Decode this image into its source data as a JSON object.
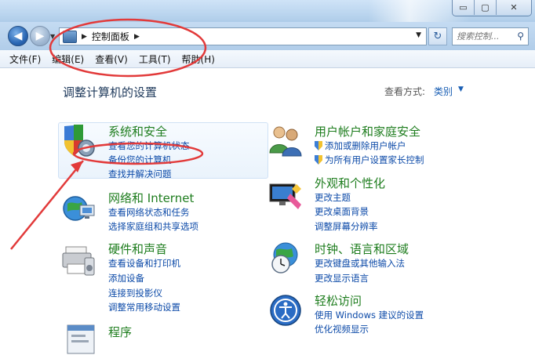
{
  "window": {
    "minimize": "▭",
    "maximize": "▢",
    "close": "✕"
  },
  "nav": {
    "back": "◀",
    "forward": "▶",
    "dropdown": "▼"
  },
  "address": {
    "separator": "▶",
    "location": "控制面板",
    "trail_arrow": "▶",
    "dropdown": "▼",
    "refresh": "↻"
  },
  "search": {
    "placeholder": "搜索控制...",
    "icon": "⚲"
  },
  "menu": [
    "文件(F)",
    "编辑(E)",
    "查看(V)",
    "工具(T)",
    "帮助(H)"
  ],
  "content": {
    "title": "调整计算机的设置",
    "view_by_label": "查看方式:",
    "view_by_value": "类别",
    "view_by_drop": "▼"
  },
  "categories": {
    "security": {
      "title": "系统和安全",
      "links": [
        "查看您的计算机状态",
        "备份您的计算机",
        "查找并解决问题"
      ]
    },
    "network": {
      "title": "网络和 Internet",
      "links": [
        "查看网络状态和任务",
        "选择家庭组和共享选项"
      ]
    },
    "hardware": {
      "title": "硬件和声音",
      "links": [
        "查看设备和打印机",
        "添加设备",
        "连接到投影仪",
        "调整常用移动设置"
      ]
    },
    "programs": {
      "title": "程序",
      "links": []
    },
    "users": {
      "title": "用户帐户和家庭安全",
      "links": [
        "添加或删除用户帐户",
        "为所有用户设置家长控制"
      ]
    },
    "appearance": {
      "title": "外观和个性化",
      "links": [
        "更改主题",
        "更改桌面背景",
        "调整屏幕分辨率"
      ]
    },
    "clock": {
      "title": "时钟、语言和区域",
      "links": [
        "更改键盘或其他输入法",
        "更改显示语言"
      ]
    },
    "ease": {
      "title": "轻松访问",
      "links": [
        "使用 Windows 建议的设置",
        "优化视频显示"
      ]
    }
  },
  "colors": {
    "annotation": "#e23a3a",
    "category_title": "#1e7d1e",
    "link": "#0c4aa8"
  }
}
